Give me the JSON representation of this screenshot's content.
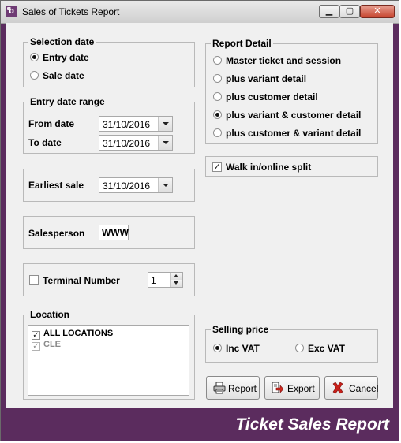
{
  "window": {
    "title": "Sales of Tickets Report",
    "app_icon_letter": "b",
    "minimize_label": "▁",
    "maximize_label": "▢",
    "close_label": "✕"
  },
  "selection_date": {
    "legend": "Selection date",
    "options": [
      {
        "label": "Entry date",
        "checked": true
      },
      {
        "label": "Sale date",
        "checked": false
      }
    ]
  },
  "entry_date_range": {
    "legend": "Entry date range",
    "from_label": "From date",
    "from_value": "31/10/2016",
    "to_label": "To date",
    "to_value": "31/10/2016"
  },
  "earliest_sale": {
    "label": "Earliest sale",
    "value": "31/10/2016"
  },
  "salesperson": {
    "label": "Salesperson",
    "value": "WWW"
  },
  "terminal": {
    "label": "Terminal Number",
    "checked": false,
    "value": "1"
  },
  "location": {
    "legend": "Location",
    "items": [
      {
        "label": "ALL LOCATIONS",
        "checked": true,
        "enabled": true
      },
      {
        "label": "CLE",
        "checked": true,
        "enabled": false
      }
    ]
  },
  "report_detail": {
    "legend": "Report Detail",
    "options": [
      {
        "label": "Master ticket and session",
        "checked": false
      },
      {
        "label": "plus variant detail",
        "checked": false
      },
      {
        "label": "plus customer detail",
        "checked": false
      },
      {
        "label": "plus variant & customer detail",
        "checked": true
      },
      {
        "label": "plus customer & variant detail",
        "checked": false
      }
    ]
  },
  "walk_in": {
    "label": "Walk in/online split",
    "checked": true
  },
  "selling_price": {
    "legend": "Selling price",
    "options": [
      {
        "label": "Inc VAT",
        "checked": true
      },
      {
        "label": "Exc VAT",
        "checked": false
      }
    ]
  },
  "buttons": {
    "report": "Report",
    "export": "Export",
    "cancel": "Cancel"
  },
  "brand_text": "Ticket Sales Report",
  "icons": {
    "report": "printer-icon",
    "export": "export-icon",
    "cancel": "red-x-icon"
  },
  "colors": {
    "frame": "#5b2c5e",
    "client": "#f0f0f0",
    "cancel_x": "#c8201a",
    "export_arrow": "#d22a1e"
  }
}
